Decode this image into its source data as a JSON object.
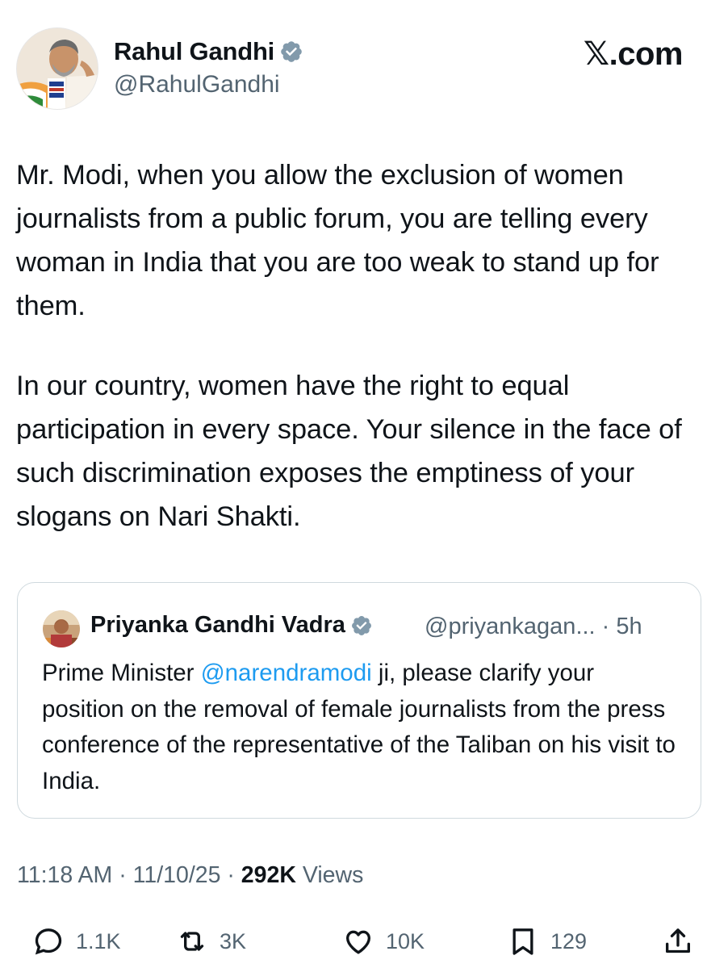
{
  "author": {
    "name": "Rahul Gandhi",
    "handle": "@RahulGandhi"
  },
  "site_label": "𝕏.com",
  "tweet": {
    "paragraphs": [
      "Mr. Modi, when you allow the exclusion of women journalists from a public forum, you are telling every woman in India that you are too weak to stand up for them.",
      "In our country, women have the right to equal participation in every space. Your silence in the face of such discrimination exposes the emptiness of your slogans on Nari Shakti."
    ]
  },
  "quoted_tweet": {
    "name": "Priyanka Gandhi Vadra",
    "handle": "@priyankagan...",
    "separator": " · ",
    "time": "5h",
    "text_before": "Prime Minister ",
    "mention": "@narendramodi",
    "text_after": " ji, please clarify your position on the removal of female journalists from the press conference of the representative of the Taliban on his visit to India."
  },
  "meta": {
    "time": "11:18 AM",
    "sep1": " · ",
    "date": "11/10/25",
    "sep2": " · ",
    "views_count": "292K",
    "views_label": " Views"
  },
  "actions": {
    "replies": "1.1K",
    "reposts": "3K",
    "likes": "10K",
    "bookmarks": "129"
  },
  "colors": {
    "text": "#0f1419",
    "secondary": "#536471",
    "link": "#1d9bf0",
    "verified": "#829aab",
    "border": "#cfd9de"
  }
}
